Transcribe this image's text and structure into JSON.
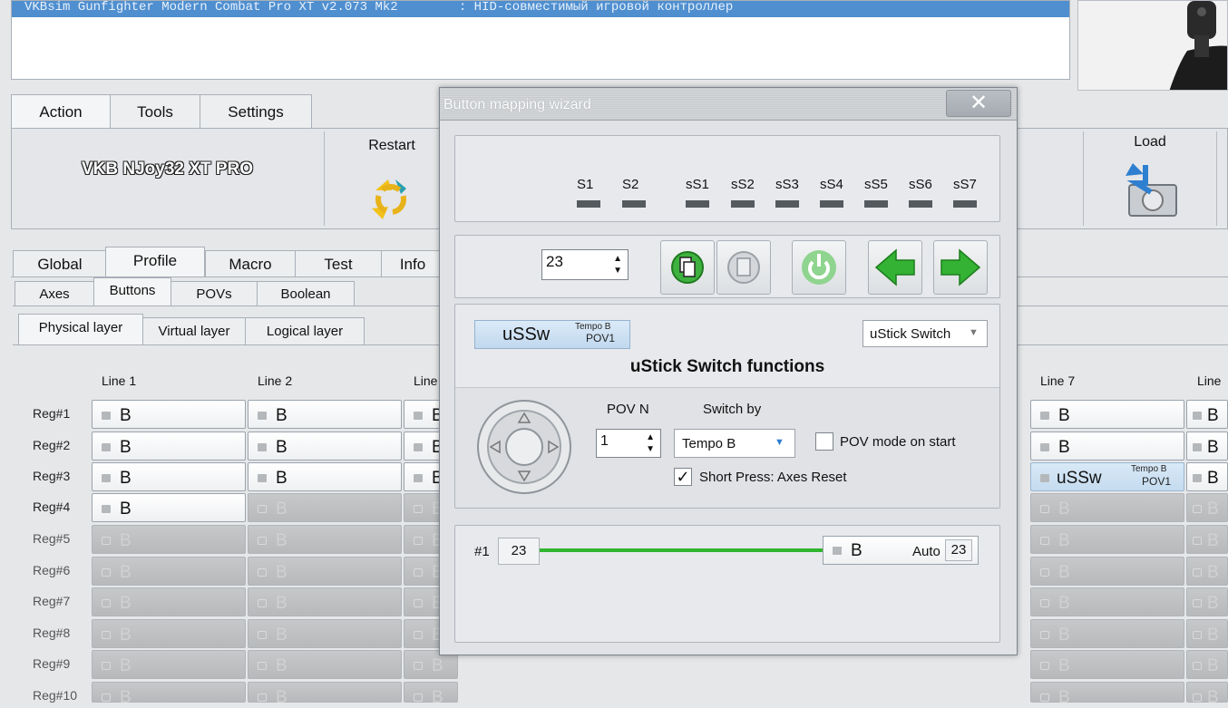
{
  "device": {
    "row_text": "VKBsim Gunfighter Modern Combat Pro XT v2.073 Mk2        : HID-совместимый игровой контроллер"
  },
  "main_tabs": [
    "Action",
    "Tools",
    "Settings"
  ],
  "action_panel": {
    "device_name": "VKB NJoy32 XT PRO",
    "restart_label": "Restart",
    "load_label": "Load"
  },
  "profile_tabs": [
    "Global",
    "Profile",
    "Macro",
    "Test",
    "Info"
  ],
  "sub_tabs": [
    "Axes",
    "Buttons",
    "POVs",
    "Boolean"
  ],
  "layer_tabs": [
    "Physical layer",
    "Virtual layer",
    "Logical layer"
  ],
  "grid": {
    "columns": [
      "Line 1",
      "Line 2",
      "Line",
      "Line 7",
      "Line"
    ],
    "rows": [
      "Reg#1",
      "Reg#2",
      "Reg#3",
      "Reg#4",
      "Reg#5",
      "Reg#6",
      "Reg#7",
      "Reg#8",
      "Reg#9",
      "Reg#10"
    ],
    "cell_label": "B",
    "ussw_label": "uSSw",
    "ussw_sub1": "Tempo B",
    "ussw_sub2": "POV1"
  },
  "dialog": {
    "title": "Button mapping wizard",
    "close_glyph": "✕",
    "switches": [
      "S1",
      "S2",
      "sS1",
      "sS2",
      "sS3",
      "sS4",
      "sS5",
      "sS6",
      "sS7"
    ],
    "button_number": "23",
    "function_tag": {
      "label": "uSSw",
      "sub1": "Tempo B",
      "sub2": "POV1"
    },
    "function_type": "uStick Switch",
    "section_title": "uStick Switch functions",
    "pov_n_label": "POV N",
    "pov_n_value": "1",
    "switch_by_label": "Switch by",
    "switch_by_value": "Tempo B",
    "pov_mode_label": "POV mode on start",
    "pov_mode_checked": false,
    "short_press_label": "Short Press: Axes Reset",
    "short_press_checked": true,
    "chain": {
      "index_label": "#1",
      "source_number": "23",
      "target_label": "B",
      "mode_label": "Auto",
      "target_number": "23"
    }
  },
  "colors": {
    "device_row_bg": "#4f8fd0",
    "ussw_bg": "#c9def1",
    "chain_line": "#2fb52f",
    "arrow_green": "#33b233"
  }
}
